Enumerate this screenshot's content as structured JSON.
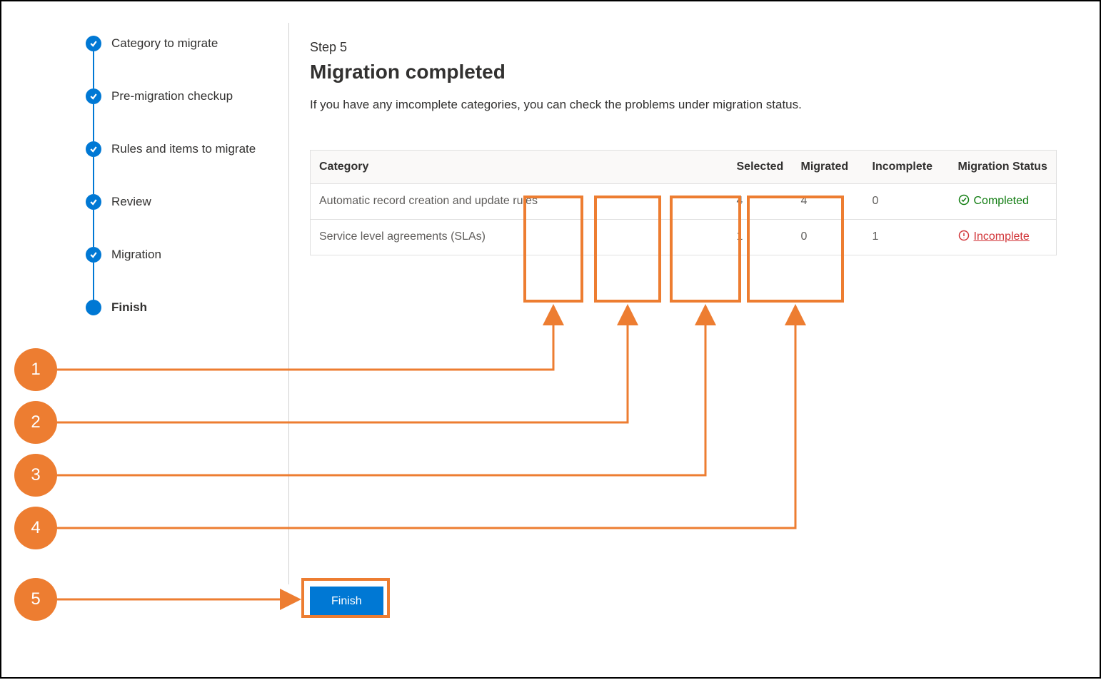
{
  "stepper": {
    "items": [
      {
        "label": "Category to migrate",
        "done": true
      },
      {
        "label": "Pre-migration checkup",
        "done": true
      },
      {
        "label": "Rules and items to migrate",
        "done": true
      },
      {
        "label": "Review",
        "done": true
      },
      {
        "label": "Migration",
        "done": true
      },
      {
        "label": "Finish",
        "current": true
      }
    ]
  },
  "main": {
    "step_label": "Step 5",
    "title": "Migration completed",
    "description": "If you have any imcomplete categories, you can check the problems under migration status."
  },
  "table": {
    "headers": {
      "category": "Category",
      "selected": "Selected",
      "migrated": "Migrated",
      "incomplete": "Incomplete",
      "status": "Migration Status"
    },
    "rows": [
      {
        "category": "Automatic record creation and update rules",
        "selected": "4",
        "migrated": "4",
        "incomplete": "0",
        "status_label": "Completed",
        "status": "completed"
      },
      {
        "category": "Service level agreements (SLAs)",
        "selected": "1",
        "migrated": "0",
        "incomplete": "1",
        "status_label": "Incomplete",
        "status": "incomplete"
      }
    ]
  },
  "finish_button": "Finish",
  "callouts": {
    "1": "1",
    "2": "2",
    "3": "3",
    "4": "4",
    "5": "5"
  },
  "colors": {
    "blue": "#0078d4",
    "orange": "#ed7d31",
    "green": "#107c10",
    "red": "#d13438"
  }
}
